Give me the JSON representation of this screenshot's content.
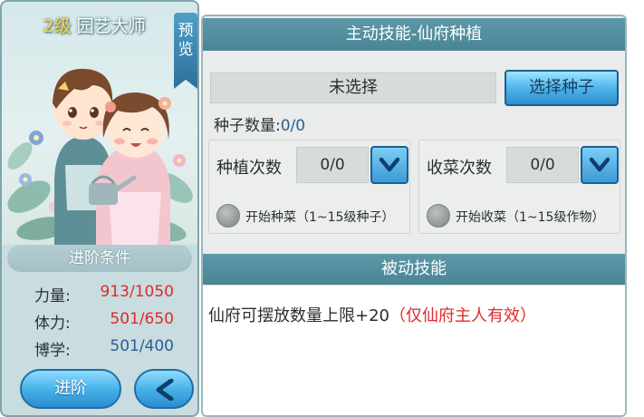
{
  "character": {
    "level": "2级",
    "title": "园艺大师",
    "preview_label": [
      "预",
      "览"
    ]
  },
  "advance": {
    "header": "进阶条件",
    "stats": [
      {
        "label": "力量:",
        "value": "913/1050",
        "status": "insufficient"
      },
      {
        "label": "体力:",
        "value": "501/650",
        "status": "insufficient"
      },
      {
        "label": "博学:",
        "value": "501/400",
        "status": "met"
      }
    ],
    "advance_button": "进阶",
    "back_icon": "chevron-left-icon"
  },
  "active_skill": {
    "header": "主动技能-仙府种植",
    "seed_field": "未选择",
    "select_seed_button": "选择种子",
    "seed_count_label": "种子数量:",
    "seed_count_value": "0/0",
    "plant": {
      "label": "种植次数",
      "value": "0/0",
      "radio_label": "开始种菜（1~15级种子）"
    },
    "harvest": {
      "label": "收菜次数",
      "value": "0/0",
      "radio_label": "开始收菜（1~15级作物）"
    }
  },
  "passive_skill": {
    "header": "被动技能",
    "effect_text": "仙府可摆放数量上限+20",
    "effect_note": "（仅仙府主人有效）"
  },
  "colors": {
    "header_bg": "#4a8596",
    "button_blue": "#43aee6",
    "warning_red": "#e12a2a",
    "value_blue": "#2a5f93"
  }
}
